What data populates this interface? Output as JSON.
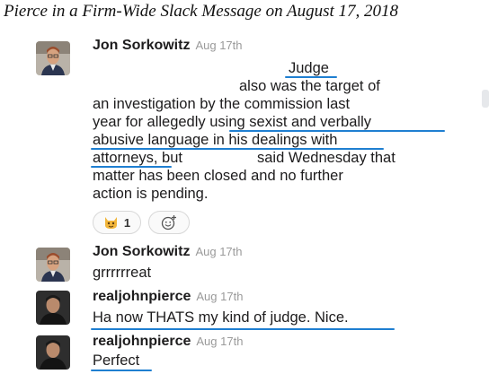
{
  "caption": "Pierce in a Firm-Wide Slack Message on August 17, 2018",
  "messages": [
    {
      "author": "Jon Sorkowitz",
      "time": "Aug 17th",
      "lines": [
        "Judge",
        "also was the target of",
        "an investigation by the commission last",
        "year for allegedly using sexist and verbally",
        "abusive language in his dealings with",
        "attorneys, but",
        "said Wednesday that",
        "matter has been closed and no further",
        "action is pending."
      ],
      "reactions": [
        {
          "icon": "cat-emoji-icon",
          "count": "1"
        },
        {
          "icon": "add-reaction-icon",
          "count": ""
        }
      ]
    },
    {
      "author": "Jon Sorkowitz",
      "time": "Aug 17th",
      "text": "grrrrrreat"
    },
    {
      "author": "realjohnpierce",
      "time": "Aug 17th",
      "text": "Ha now THATS my kind of judge. Nice."
    },
    {
      "author": "realjohnpierce",
      "time": "Aug 17th",
      "text": "Perfect"
    }
  ],
  "colors": {
    "underline": "#1f7fd1",
    "timestamp": "#9a9a9a"
  }
}
